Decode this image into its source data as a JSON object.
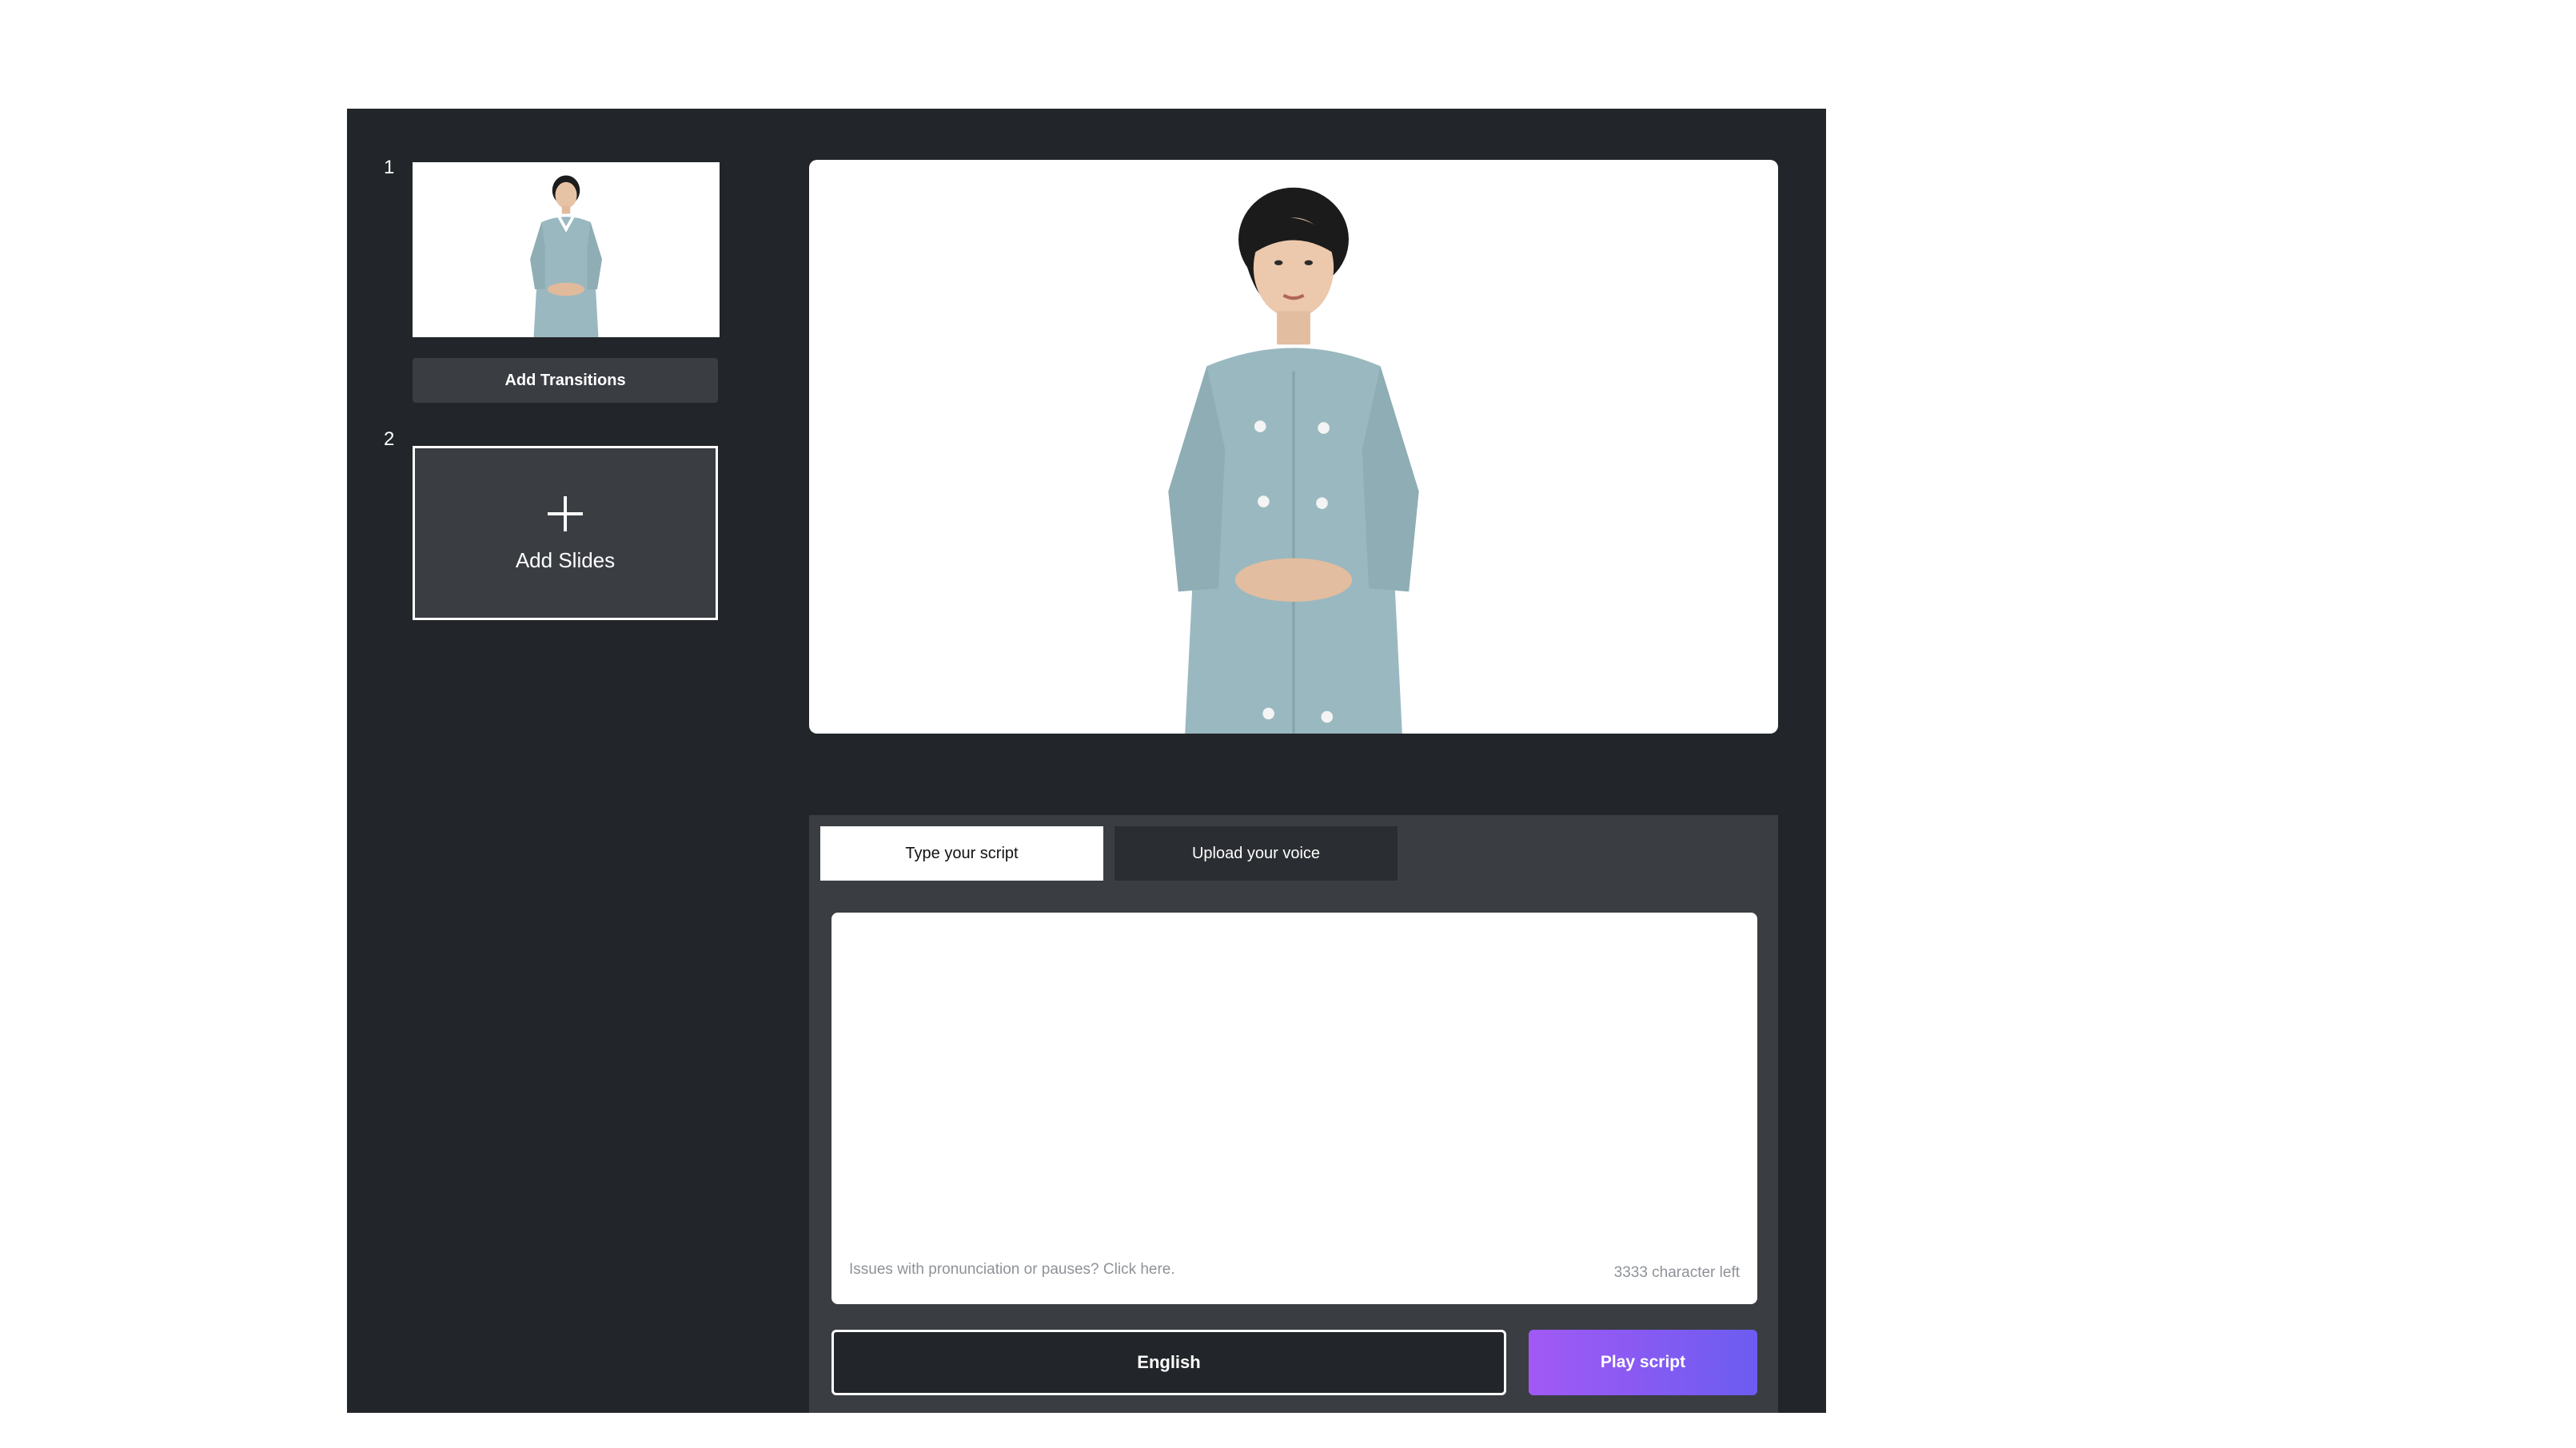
{
  "sidebar": {
    "slides": [
      {
        "number": "1"
      },
      {
        "number": "2"
      }
    ],
    "add_transitions_label": "Add Transitions",
    "add_slides_label": "Add Slides"
  },
  "script": {
    "tabs": [
      {
        "label": "Type your script",
        "active": true
      },
      {
        "label": "Upload your voice",
        "active": false
      }
    ],
    "text_value": "",
    "help_text": "Issues with pronunciation or pauses? Click here.",
    "char_left": "3333 character left",
    "language": "English",
    "play_label": "Play script"
  },
  "colors": {
    "background": "#222529",
    "panel": "#3a3d42",
    "accent_start": "#a259f5",
    "accent_end": "#6c5cf0",
    "dress": "#9ab8c0"
  },
  "icons": {
    "add": "plus-icon"
  }
}
